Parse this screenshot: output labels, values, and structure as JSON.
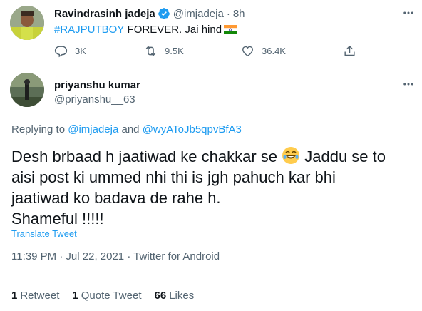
{
  "parent_tweet": {
    "author_name": "Ravindrasinh jadeja",
    "handle": "@imjadeja",
    "separator": "·",
    "time_ago": "8h",
    "hashtag": "#RAJPUTBOY",
    "text": " FOREVER. Jai hind",
    "flag_emoji": "🇮🇳",
    "actions": {
      "replies": "3K",
      "retweets": "9.5K",
      "likes": "36.4K"
    }
  },
  "main_tweet": {
    "author_name": "priyanshu kumar",
    "handle": "@priyanshu__63",
    "replying_to": {
      "prefix": "Replying to",
      "user1": "@imjadeja",
      "conjunction": "and",
      "user2": "@wyAToJb5qpvBfA3"
    },
    "text_line1_before": "Desh brbaad h jaatiwad ke chakkar se",
    "laugh_emoji": "🤣",
    "text_line1_after": "Jaddu se to",
    "text_line2": "aisi post ki ummed nhi thi is jgh pahuch kar bhi",
    "text_line3": "jaatiwad ko badava de rahe h.",
    "text_line4": "Shameful !!!!!",
    "translate": "Translate Tweet",
    "timestamp": "11:39 PM · Jul 22, 2021 · Twitter for Android",
    "stats": {
      "retweets_count": "1",
      "retweets_label": "Retweet",
      "quotes_count": "1",
      "quotes_label": "Quote Tweet",
      "likes_count": "66",
      "likes_label": "Likes"
    }
  },
  "colors": {
    "accent": "#1d9bf0",
    "verified": "#1d9bf0",
    "muted": "#536471"
  }
}
